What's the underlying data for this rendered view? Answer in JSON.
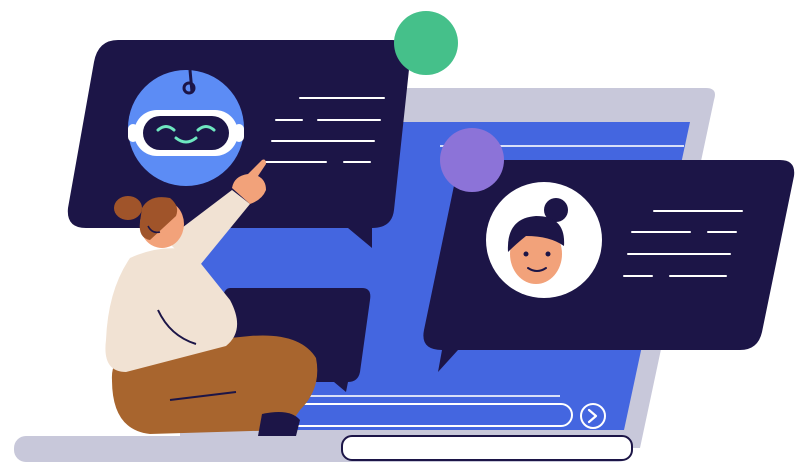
{
  "illustration": {
    "theme": "chatbot-conversation",
    "badge_typing": "...",
    "badge_question": "?",
    "icons": {
      "typing_badge": "typing-indicator-icon",
      "question_badge": "question-mark-icon",
      "robot": "robot-avatar-icon",
      "person": "woman-avatar-icon",
      "send": "arrow-right-circle-icon"
    },
    "colors": {
      "navy": "#1c1547",
      "screen_blue": "#4466e0",
      "frame_grey": "#c8c8da",
      "robot_bg": "#5c8cf5",
      "bot_face": "#1c1547",
      "bot_eyes": "#6ee7c0",
      "typing_green": "#45c08a",
      "question_purple": "#8c73d8",
      "skin": "#f2a27a",
      "hair": "#a0542a",
      "sweater": "#f1e2d3",
      "pants": "#a8652e",
      "text_lines": "#ffffff"
    }
  }
}
